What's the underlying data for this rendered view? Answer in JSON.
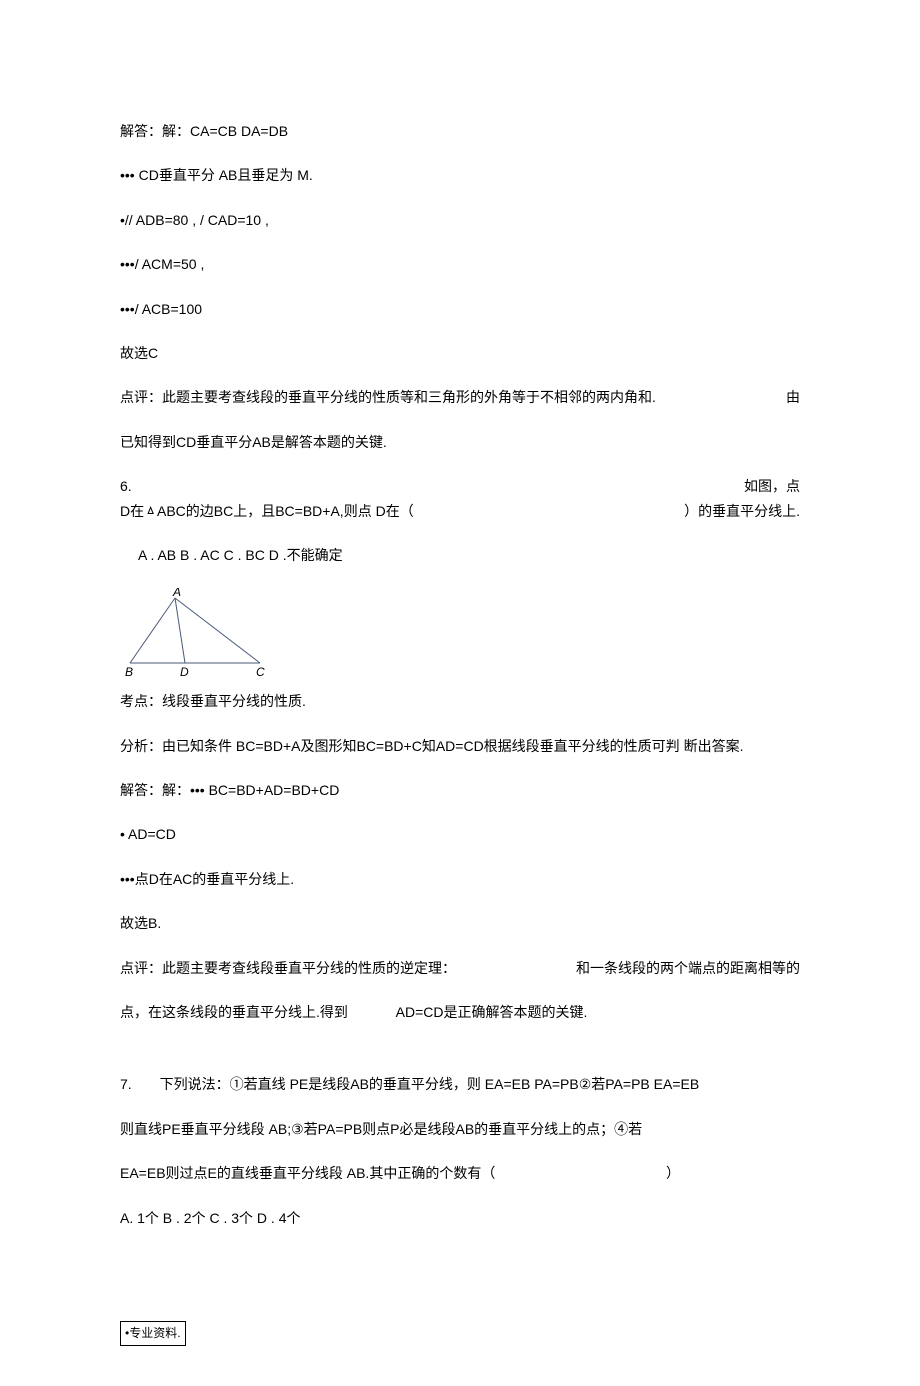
{
  "line1": "解答：解：CA=CB DA=DB",
  "line2": "••• CD垂直平分 AB且垂足为 M.",
  "line3": "•// ADB=80 , / CAD=10 ,",
  "line4": "•••/ ACM=50 ,",
  "line5": "•••/ ACB=100",
  "line6": "故选C",
  "evalLine": {
    "left": "点评：此题主要考查线段的垂直平分线的性质等和三角形的外角等于不相邻的两内角和.",
    "right": "由"
  },
  "evalLine2": "已知得到CD垂直平分AB是解答本题的关键.",
  "q6": {
    "row1Left": "6.",
    "row1Right": "如图，点",
    "row2Left": "D在ㅿABC的边BC上，且BC=BD+A,则点 D在（",
    "row2Right": "）的垂直平分线上.",
    "options": "A . AB B . AC C . BC D .不能确定"
  },
  "triangleLabels": {
    "A": "A",
    "B": "B",
    "D": "D",
    "C": "C"
  },
  "p6line1": "考点：线段垂直平分线的性质.",
  "p6line2": "分析：由已知条件 BC=BD+A及图形知BC=BD+C知AD=CD根据线段垂直平分线的性质可判 断出答案.",
  "p6line3": "解答：解：••• BC=BD+AD=BD+CD",
  "p6line4": "• AD=CD",
  "p6line5": "•••点D在AC的垂直平分线上.",
  "p6line6": "故选B.",
  "p6evalRow": {
    "left": "点评：此题主要考查线段垂直平分线的性质的逆定理：",
    "right": "和一条线段的两个端点的距离相等的"
  },
  "p6evalRow2": {
    "left": "点，在这条线段的垂直平分线上.得到",
    "right": "AD=CD是正确解答本题的关键."
  },
  "q7": {
    "line1": "7.　　下列说法：①若直线 PE是线段AB的垂直平分线，则 EA=EB PA=PB②若PA=PB EA=EB",
    "line2": "则直线PE垂直平分线段 AB;③若PA=PB则点P必是线段AB的垂直平分线上的点；④若",
    "line3Left": "EA=EB则过点E的直线垂直平分线段 AB.其中正确的个数有（",
    "line3Right": "）",
    "options": "A. 1个 B . 2个 C . 3个 D . 4个"
  },
  "footer": "•专业资料."
}
